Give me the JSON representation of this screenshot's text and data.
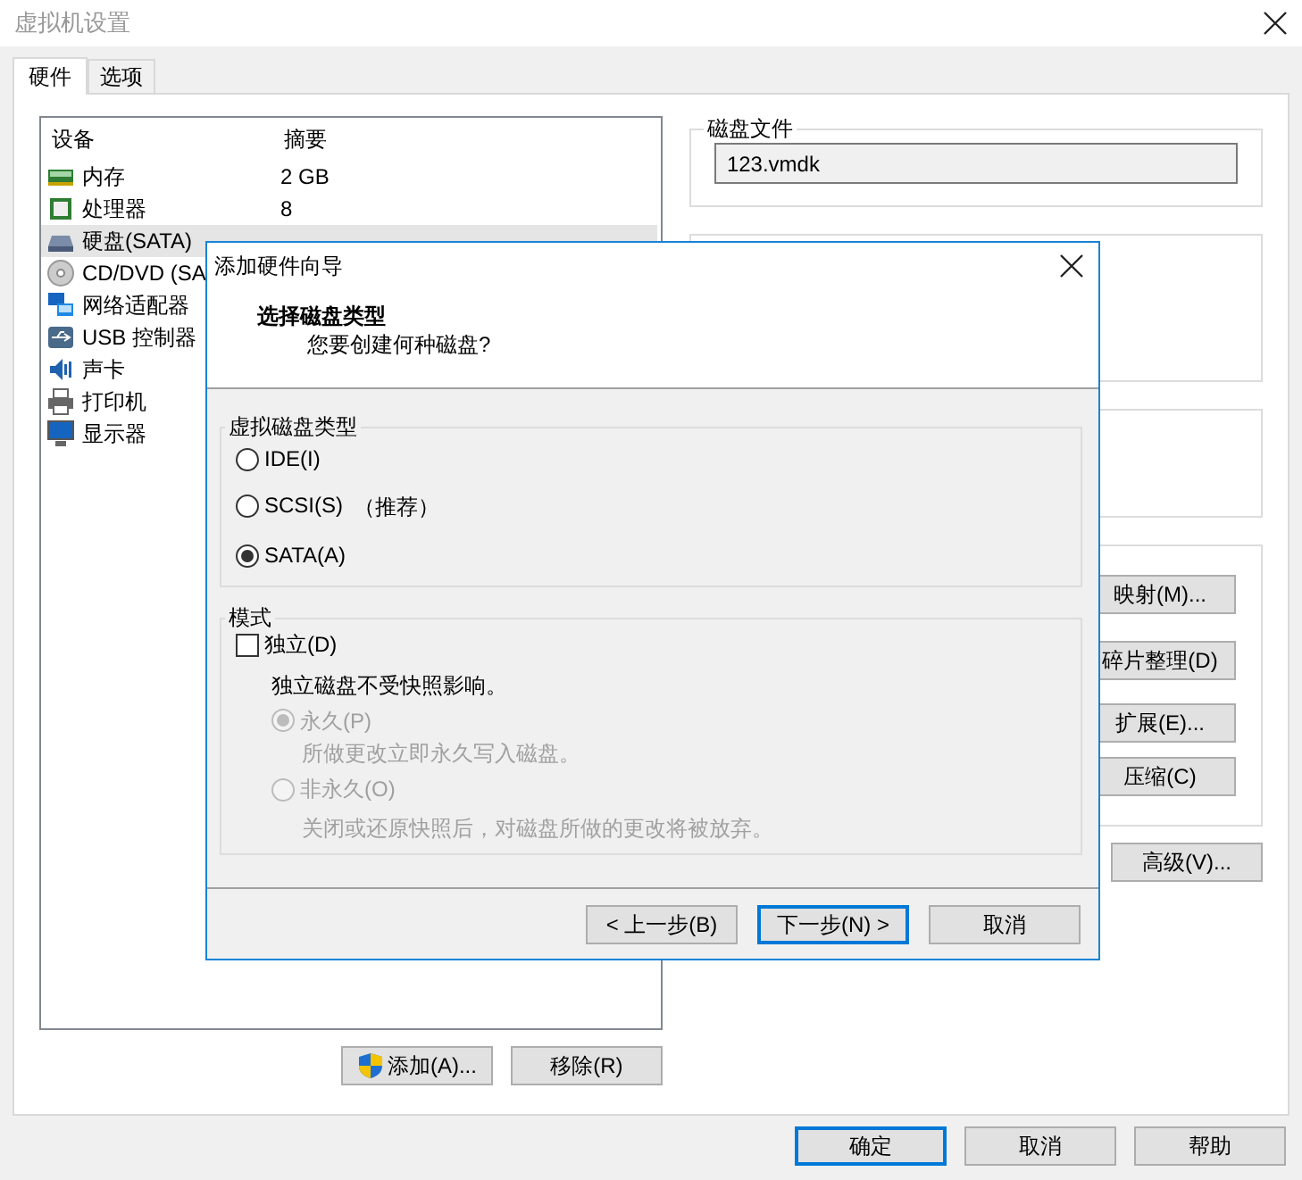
{
  "window": {
    "title": "虚拟机设置"
  },
  "tabs": [
    {
      "label": "硬件",
      "selected": true
    },
    {
      "label": "选项",
      "selected": false
    }
  ],
  "device_list": {
    "columns": [
      "设备",
      "摘要"
    ],
    "rows": [
      {
        "kind": "memory",
        "device": "内存",
        "summary": "2 GB",
        "selected": false
      },
      {
        "kind": "cpu",
        "device": "处理器",
        "summary": "8",
        "selected": false
      },
      {
        "kind": "disk",
        "device": "硬盘(SATA)",
        "selected": true
      },
      {
        "kind": "cdrom",
        "device": "CD/DVD (SA",
        "selected": false
      },
      {
        "kind": "network",
        "device": "网络适配器",
        "selected": false
      },
      {
        "kind": "usb",
        "device": "USB 控制器",
        "selected": false
      },
      {
        "kind": "sound",
        "device": "声卡",
        "selected": false
      },
      {
        "kind": "printer",
        "device": "打印机",
        "selected": false
      },
      {
        "kind": "display",
        "device": "显示器",
        "selected": false
      }
    ]
  },
  "list_buttons": [
    {
      "label": "添加(A)...",
      "kind": "shield"
    },
    {
      "label": "移除(R)",
      "kind": "plain"
    }
  ],
  "disk_file": {
    "title": "磁盘文件",
    "value": "123.vmdk"
  },
  "disk_utilities": [
    "映射(M)...",
    "碎片整理(D)",
    "扩展(E)...",
    "压缩(C)"
  ],
  "advanced_button": "高级(V)...",
  "footer_buttons": [
    {
      "label": "确定",
      "default": true
    },
    {
      "label": "取消",
      "default": false
    },
    {
      "label": "帮助",
      "default": false
    }
  ],
  "dialog": {
    "title": "添加硬件向导",
    "heading": "选择磁盘类型",
    "subtitle": "您要创建何种磁盘?",
    "type_group": {
      "title": "虚拟磁盘类型",
      "options": [
        {
          "label": "IDE(I)",
          "selected": false
        },
        {
          "label": "SCSI(S)",
          "note": "（推荐）",
          "selected": false
        },
        {
          "label": "SATA(A)",
          "selected": true
        }
      ]
    },
    "mode_group": {
      "title": "模式",
      "independent": {
        "label": "独立(D)",
        "checked": false
      },
      "description": "独立磁盘不受快照影响。",
      "options": [
        {
          "label": "永久(P)",
          "description": "所做更改立即永久写入磁盘。",
          "selected": true,
          "disabled": true
        },
        {
          "label": "非永久(O)",
          "description": "关闭或还原快照后，对磁盘所做的更改将被放弃。",
          "selected": false,
          "disabled": true
        }
      ]
    },
    "buttons": [
      {
        "label": "< 上一步(B)",
        "default": false
      },
      {
        "label": "下一步(N) >",
        "default": true
      },
      {
        "label": "取消",
        "default": false
      }
    ]
  }
}
